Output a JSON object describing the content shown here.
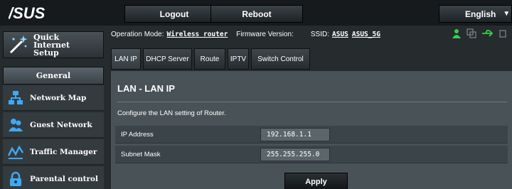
{
  "brand": {
    "logo_text": "/SUS"
  },
  "topbar": {
    "logout_label": "Logout",
    "reboot_label": "Reboot",
    "language": "English"
  },
  "sidebar": {
    "quick_setup_label": "Quick Internet Setup",
    "general_label": "General",
    "items": [
      {
        "label": "Network Map",
        "icon": "network-map-icon"
      },
      {
        "label": "Guest Network",
        "icon": "guest-network-icon"
      },
      {
        "label": "Traffic Manager",
        "icon": "traffic-manager-icon"
      },
      {
        "label": "Parental control",
        "icon": "parental-control-icon"
      }
    ]
  },
  "status": {
    "operation_mode_label": "Operation Mode:",
    "operation_mode_value": "Wireless router",
    "firmware_label": "Firmware Version:",
    "ssid_label": "SSID:",
    "ssid_values": [
      "ASUS",
      "ASUS_5G"
    ]
  },
  "tabs": [
    "LAN IP",
    "DHCP Server",
    "Route",
    "IPTV",
    "Switch Control"
  ],
  "main": {
    "title": "LAN - LAN IP",
    "description": "Configure the LAN setting of Router.",
    "fields": [
      {
        "label": "IP Address",
        "value": "192.168.1.1"
      },
      {
        "label": "Subnet Mask",
        "value": "255.255.255.0"
      }
    ],
    "apply_label": "Apply"
  },
  "colors": {
    "accent_green": "#34d14a",
    "panel_bg": "#495357",
    "sidebar_bg": "#262b2e"
  }
}
